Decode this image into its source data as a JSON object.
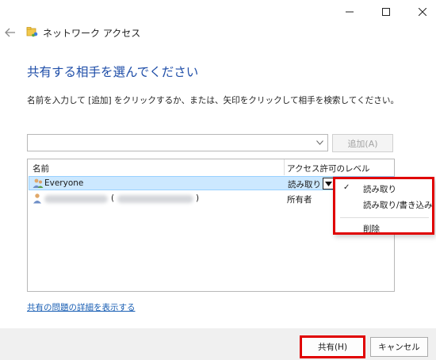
{
  "window": {
    "title": "ネットワーク アクセス"
  },
  "heading": "共有する相手を選んでください",
  "instructions": "名前を入力して [追加] をクリックするか、または、矢印をクリックして相手を検索してください。",
  "name_input": {
    "value": "",
    "placeholder": ""
  },
  "add_button": "追加(A)",
  "table": {
    "columns": [
      "名前",
      "アクセス許可のレベル"
    ],
    "rows": [
      {
        "name": "Everyone",
        "permission": "読み取り",
        "selected": true
      },
      {
        "name": "(",
        "name_suffix": ")",
        "permission": "所有者",
        "selected": false
      }
    ]
  },
  "context_menu": {
    "items": [
      {
        "label": "読み取り",
        "checked": true
      },
      {
        "label": "読み取り/書き込み",
        "checked": false
      },
      {
        "label": "削除",
        "checked": false
      }
    ],
    "check_glyph": "✓"
  },
  "help_link": "共有の問題の詳細を表示する",
  "share_button": "共有(H)",
  "cancel_button": "キャンセル",
  "colors": {
    "heading": "#1f4ea8",
    "highlight": "#e00000",
    "selection": "#cce8ff"
  }
}
